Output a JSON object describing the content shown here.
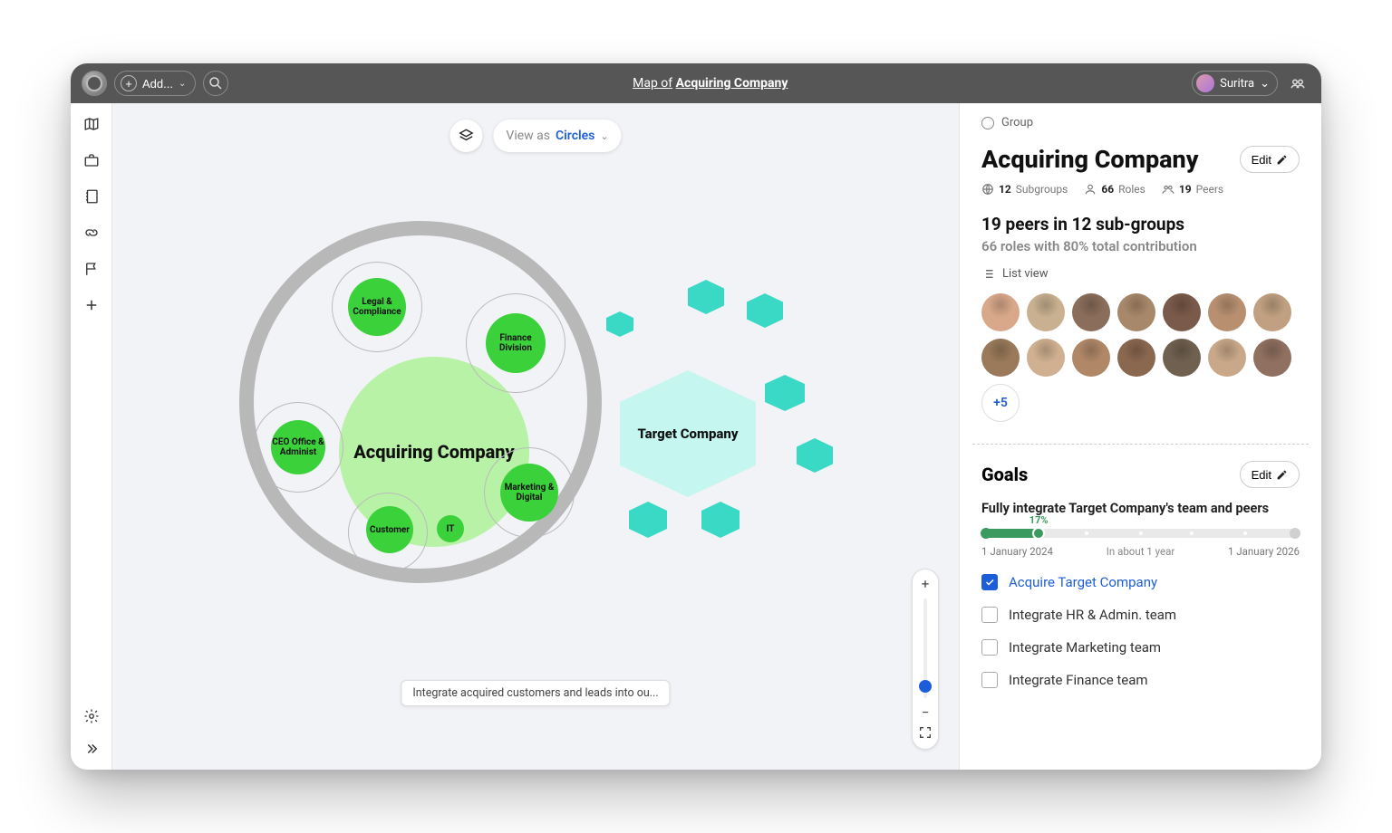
{
  "header": {
    "add_label": "Add...",
    "map_prefix": "Map of",
    "map_title": "Acquiring Company",
    "user_name": "Suritra"
  },
  "canvas": {
    "view_as_label": "View as",
    "view_as_value": "Circles",
    "tooltip": "Integrate acquired customers and leads into ou...",
    "main_entity": "Acquiring Company",
    "target_entity": "Target Company",
    "subgroups": {
      "legal": "Legal & Compliance",
      "finance": "Finance Division",
      "ceo": "CEO Office & Administ",
      "customer": "Customer",
      "it": "IT",
      "marketing": "Marketing & Digital"
    }
  },
  "panel": {
    "crumb": "Group",
    "title": "Acquiring Company",
    "edit_label": "Edit",
    "meta": {
      "subgroups_n": "12",
      "subgroups_l": "Subgroups",
      "roles_n": "66",
      "roles_l": "Roles",
      "peers_n": "19",
      "peers_l": "Peers"
    },
    "subhead": "19 peers in 12 sub-groups",
    "subhead2": "66 roles with 80% total contribution",
    "listview": "List view",
    "more": "+5",
    "goals_heading": "Goals",
    "goal_title": "Fully integrate Target Company's team and peers",
    "progress_pct": "17%",
    "progress_start": "1 January 2024",
    "progress_mid": "In about 1 year",
    "progress_end": "1 January 2026",
    "tasks": [
      {
        "done": true,
        "label": "Acquire Target Company"
      },
      {
        "done": false,
        "label": "Integrate HR & Admin. team"
      },
      {
        "done": false,
        "label": "Integrate Marketing team"
      },
      {
        "done": false,
        "label": "Integrate Finance team"
      }
    ]
  },
  "avatar_colors": [
    "#d9a88a",
    "#c8b090",
    "#8a6d5a",
    "#a8886a",
    "#7a5a4a",
    "#b89070",
    "#c0a080",
    "#9a7a5a",
    "#d0b090",
    "#b08868",
    "#8a6850",
    "#706050",
    "#c8a888",
    "#907060"
  ]
}
